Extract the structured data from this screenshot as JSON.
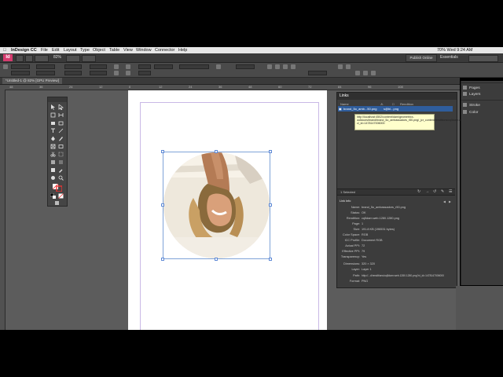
{
  "menu": {
    "apple": "",
    "items": [
      "InDesign CC",
      "File",
      "Edit",
      "Layout",
      "Type",
      "Object",
      "Table",
      "View",
      "Window",
      "Connector",
      "Help"
    ],
    "status": "70%  Wed 9:24 AM"
  },
  "app_bar": {
    "logo": "Id",
    "zoom": "82%",
    "publish_label": "Publish Online",
    "workspace": "Essentials"
  },
  "document": {
    "tab_title": "*Untitled-1 @ 82% [GPU Preview]",
    "ruler_ticks": [
      "48",
      "36",
      "24",
      "12",
      "0",
      "12",
      "24",
      "36",
      "48",
      "60",
      "72",
      "84",
      "96",
      "108"
    ]
  },
  "links": {
    "panel_title": "Links",
    "col_name": "Name",
    "col_rendition": "Rendition",
    "selected_file": "brand_5o_amb...50.png",
    "selected_rendition": "s@bl...png",
    "tooltip": "http://localhost:4502/content/dam/geometrixx-outdoors/brand/brand_5o_ambassadors_r50.png/_jcr_content/renditions/cq5dam.web.1280.1280.png?cl_id=1478147006000",
    "selected_count": "1 Selected",
    "info_title": "Link Info",
    "info": [
      {
        "k": "Name:",
        "v": "brand_5o_ambassadors_r50.png"
      },
      {
        "k": "Status:",
        "v": "OK"
      },
      {
        "k": "Rendition:",
        "v": "cq5dam.web.1280.1280.png"
      },
      {
        "k": "Page:",
        "v": "1"
      },
      {
        "k": "Size:",
        "v": "191.8 KB (196531 bytes)"
      },
      {
        "k": "Color Space:",
        "v": "RGB"
      },
      {
        "k": "ICC Profile:",
        "v": "Document RGB"
      },
      {
        "k": "Actual PPI:",
        "v": "72"
      },
      {
        "k": "Effective PPI:",
        "v": "79"
      },
      {
        "k": "Transparency:",
        "v": "Yes"
      },
      {
        "k": "Dimensions:",
        "v": "320 × 320"
      },
      {
        "k": "Layer:",
        "v": "Layer 1"
      },
      {
        "k": "Path:",
        "v": "http://...d/renditions/cq5dam.web.1280.1280.png?cl_id=1478147006000"
      },
      {
        "k": "Format:",
        "v": "PNG"
      }
    ]
  },
  "right_panel": {
    "items": [
      "Pages",
      "Layers",
      "Stroke",
      "Color"
    ]
  },
  "colors": {
    "accent": "#d63c6f",
    "selection": "#2f5d9c",
    "tooltip_bg": "#ffffcc"
  }
}
